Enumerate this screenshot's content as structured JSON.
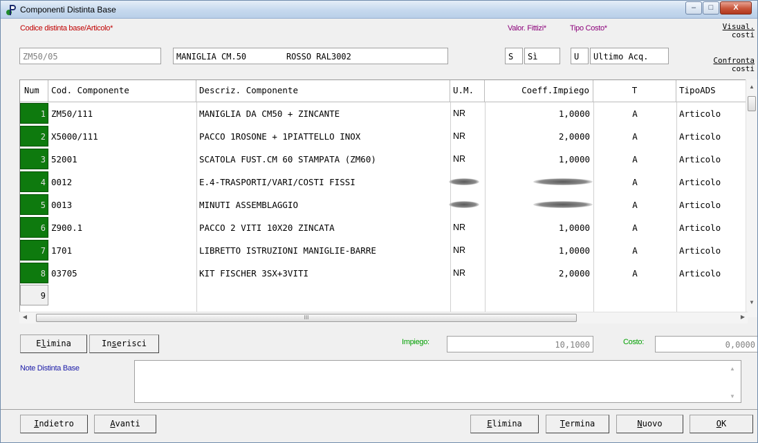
{
  "window": {
    "title": "Componenti Distinta Base",
    "minimize": "–",
    "maximize": "□",
    "close": "X"
  },
  "header": {
    "codice_label": "Codice distinta base/Articolo*",
    "codice_value": "ZM50/05",
    "descrizione_value": "MANIGLIA CM.50        ROSSO RAL3002",
    "valor_fittizi_label": "Valor. Fittizi*",
    "valor_fittizi_code": "S",
    "valor_fittizi_value": "Sì",
    "tipo_costo_label": "Tipo Costo*",
    "tipo_costo_code": "U",
    "tipo_costo_value": "Ultimo Acq.",
    "visual_costi_line1": "Visual.",
    "visual_costi_line2": "costi",
    "confronta_costi_line1": "Confronta",
    "confronta_costi_line2": "costi"
  },
  "grid": {
    "columns": [
      "Num",
      "Cod. Componente",
      "Descriz. Componente",
      "U.M.",
      "Coeff.Impiego",
      "T",
      "TipoADS"
    ],
    "rows": [
      {
        "num": "1",
        "cod": "ZM50/111",
        "desc": "MANIGLIA DA CM50 + ZINCANTE",
        "um": "NR",
        "coeff": "1,0000",
        "t": "A",
        "tipo": "Articolo",
        "blurred": false
      },
      {
        "num": "2",
        "cod": "X5000/111",
        "desc": "PACCO 1ROSONE + 1PIATTELLO INOX",
        "um": "NR",
        "coeff": "2,0000",
        "t": "A",
        "tipo": "Articolo",
        "blurred": false
      },
      {
        "num": "3",
        "cod": "52001",
        "desc": "SCATOLA FUST.CM 60 STAMPATA (ZM60)",
        "um": "NR",
        "coeff": "1,0000",
        "t": "A",
        "tipo": "Articolo",
        "blurred": false
      },
      {
        "num": "4",
        "cod": "0012",
        "desc": "E.4-TRASPORTI/VARI/COSTI FISSI",
        "um": "",
        "coeff": "",
        "t": "A",
        "tipo": "Articolo",
        "blurred": true
      },
      {
        "num": "5",
        "cod": "0013",
        "desc": "MINUTI ASSEMBLAGGIO",
        "um": "",
        "coeff": "",
        "t": "A",
        "tipo": "Articolo",
        "blurred": true
      },
      {
        "num": "6",
        "cod": "Z900.1",
        "desc": "PACCO 2 VITI 10X20 ZINCATA",
        "um": "NR",
        "coeff": "1,0000",
        "t": "A",
        "tipo": "Articolo",
        "blurred": false
      },
      {
        "num": "7",
        "cod": "1701",
        "desc": "LIBRETTO ISTRUZIONI MANIGLIE-BARRE",
        "um": "NR",
        "coeff": "1,0000",
        "t": "A",
        "tipo": "Articolo",
        "blurred": false
      },
      {
        "num": "8",
        "cod": "03705",
        "desc": "KIT FISCHER 3SX+3VITI",
        "um": "NR",
        "coeff": "2,0000",
        "t": "A",
        "tipo": "Articolo",
        "blurred": false
      }
    ],
    "empty_row_num": "9",
    "scroll_grip": "III"
  },
  "actions_row": {
    "elimina_pre": "E",
    "elimina_u": "l",
    "elimina_post": "imina",
    "inserisci_pre": "In",
    "inserisci_u": "s",
    "inserisci_post": "erisci",
    "impiego_label": "Impiego:",
    "impiego_value": "10,1000",
    "costo_label": "Costo:",
    "costo_value": "0,0000"
  },
  "note": {
    "label": "Note Distinta Base",
    "value": ""
  },
  "footer": {
    "indietro_u": "I",
    "indietro_post": "ndietro",
    "avanti_u": "A",
    "avanti_post": "vanti",
    "elimina_u": "E",
    "elimina_post": "limina",
    "termina_u": "T",
    "termina_post": "ermina",
    "nuovo_u": "N",
    "nuovo_post": "uovo",
    "ok_pre": "",
    "ok_u": "O",
    "ok_post": "K"
  }
}
